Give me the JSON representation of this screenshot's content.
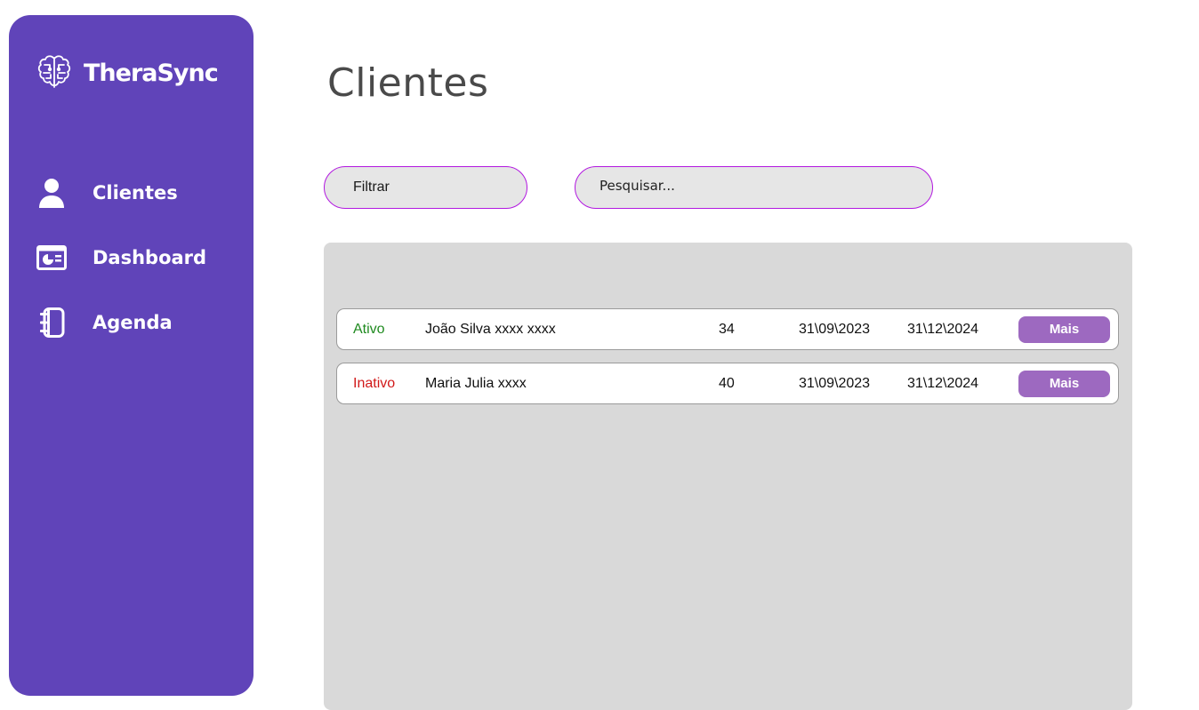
{
  "brand": {
    "name": "TheraSync",
    "icon": "brain-icon"
  },
  "sidebar": {
    "items": [
      {
        "label": "Clientes",
        "icon": "user-icon"
      },
      {
        "label": "Dashboard",
        "icon": "dashboard-icon"
      },
      {
        "label": "Agenda",
        "icon": "notebook-icon"
      }
    ]
  },
  "page": {
    "title": "Clientes"
  },
  "toolbar": {
    "filter_label": "Filtrar",
    "search_placeholder": "Pesquisar..."
  },
  "colors": {
    "sidebar_bg": "#6044b9",
    "accent_border": "#b218e0",
    "button_bg": "#9d69c0",
    "status_active": "#1f8a1f",
    "status_inactive": "#d11a1a"
  },
  "clients": [
    {
      "status": "Ativo",
      "status_color": "#1f8a1f",
      "name": "João Silva xxxx xxxx",
      "age": "34",
      "date_start": "31\\09\\2023",
      "date_end": "31\\12\\2024",
      "action": "Mais"
    },
    {
      "status": "Inativo",
      "status_color": "#d11a1a",
      "name": "Maria Julia xxxx",
      "age": "40",
      "date_start": "31\\09\\2023",
      "date_end": "31\\12\\2024",
      "action": "Mais"
    }
  ]
}
